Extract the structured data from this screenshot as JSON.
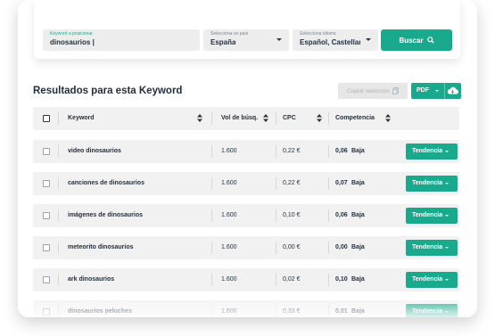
{
  "search": {
    "keyword_label": "Keyword a posicionar",
    "keyword_value": "dinosaurios |",
    "country_label": "Selecciona un país",
    "country_value": "España",
    "language_label": "Selecciona idioma",
    "language_value": "Español, Castellano",
    "search_button": "Buscar"
  },
  "results": {
    "title": "Resultados para esta Keyword",
    "copy_button": "Copiar selección",
    "pdf_button": "PDF"
  },
  "table": {
    "headers": {
      "keyword": "Keyword",
      "volume": "Vol de búsq.",
      "cpc": "CPC",
      "competition": "Competencia"
    },
    "rows": [
      {
        "keyword": "video dinosaurios",
        "volume": "1.600",
        "cpc": "0,22 €",
        "comp_value": "0,06",
        "comp_level": "Baja",
        "trend_label": "Tendencia"
      },
      {
        "keyword": "canciones de dinosaurios",
        "volume": "1.600",
        "cpc": "0,22 €",
        "comp_value": "0,07",
        "comp_level": "Baja",
        "trend_label": "Tendencia"
      },
      {
        "keyword": "imágenes de dinosaurios",
        "volume": "1.600",
        "cpc": "0,10 €",
        "comp_value": "0,06",
        "comp_level": "Baja",
        "trend_label": "Tendencia"
      },
      {
        "keyword": "meteorito dinosaurios",
        "volume": "1.600",
        "cpc": "0,00 €",
        "comp_value": "0,00",
        "comp_level": "Baja",
        "trend_label": "Tendencia"
      },
      {
        "keyword": "ark dinosaurios",
        "volume": "1.600",
        "cpc": "0,02 €",
        "comp_value": "0,10",
        "comp_level": "Baja",
        "trend_label": "Tendencia"
      },
      {
        "keyword": "dinosaurios peluches",
        "volume": "1.600",
        "cpc": "0,33 €",
        "comp_value": "0,01",
        "comp_level": "Baja",
        "trend_label": "Tendencia"
      }
    ]
  },
  "colors": {
    "accent": "#19a98c",
    "row_bg": "#f1f1f1",
    "text": "#1f2d3d"
  }
}
